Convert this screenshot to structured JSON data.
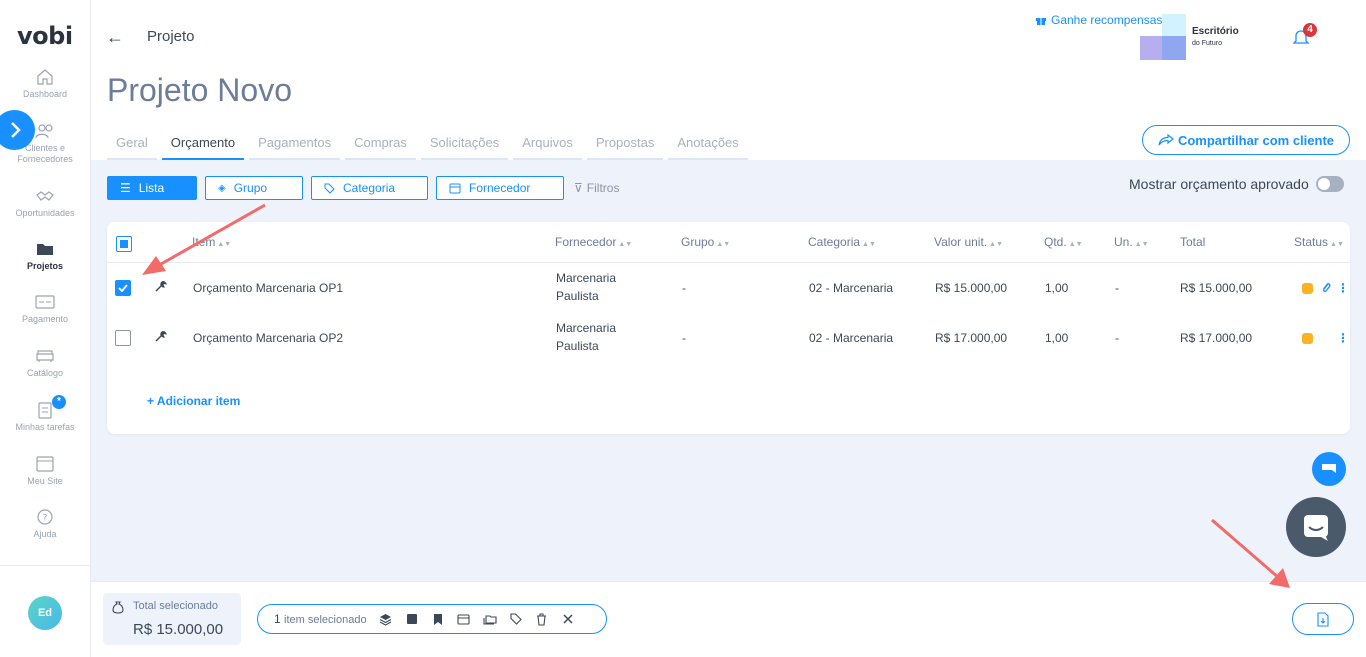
{
  "app": {
    "logo": "vobi"
  },
  "sidebar": {
    "items": [
      {
        "label": "Dashboard",
        "icon": "home-icon"
      },
      {
        "label": "Clientes e Fornecedores",
        "icon": "users-icon"
      },
      {
        "label": "Oportunidades",
        "icon": "handshake-icon"
      },
      {
        "label": "Projetos",
        "icon": "folder-icon",
        "active": true
      },
      {
        "label": "Pagamento",
        "icon": "payment-icon"
      },
      {
        "label": "Catálogo",
        "icon": "sofa-icon"
      },
      {
        "label": "Minhas tarefas",
        "icon": "clipboard-icon"
      },
      {
        "label": "Meu Site",
        "icon": "browser-icon"
      },
      {
        "label": "Ajuda",
        "icon": "help-icon"
      }
    ],
    "tasks_badge": "*",
    "avatar_initials": "Ed"
  },
  "header": {
    "breadcrumb": "Projeto",
    "title": "Projeto Novo",
    "rewards": "Ganhe recompensas!",
    "company_name": "Escritório",
    "company_sub": "do Futuro",
    "notifications_count": "4"
  },
  "tabs": [
    {
      "label": "Geral"
    },
    {
      "label": "Orçamento",
      "active": true
    },
    {
      "label": "Pagamentos"
    },
    {
      "label": "Compras"
    },
    {
      "label": "Solicitações"
    },
    {
      "label": "Arquivos"
    },
    {
      "label": "Propostas"
    },
    {
      "label": "Anotações"
    }
  ],
  "share_button": "Compartilhar com cliente",
  "filters": {
    "lista": "Lista",
    "grupo": "Grupo",
    "categoria": "Categoria",
    "fornecedor": "Fornecedor",
    "filtros": "Filtros",
    "approved_toggle": "Mostrar orçamento aprovado"
  },
  "table": {
    "columns": [
      "Item",
      "Fornecedor",
      "Grupo",
      "Categoria",
      "Valor unit.",
      "Qtd.",
      "Un.",
      "Total",
      "Status"
    ],
    "rows": [
      {
        "checked": true,
        "item": "Orçamento Marcenaria OP1",
        "fornecedor_1": "Marcenaria",
        "fornecedor_2": "Paulista",
        "grupo": "-",
        "categoria": "02 - Marcenaria",
        "valor": "R$ 15.000,00",
        "qtd": "1,00",
        "un": "-",
        "total": "R$ 15.000,00",
        "has_attachment": true
      },
      {
        "checked": false,
        "item": "Orçamento Marcenaria OP2",
        "fornecedor_1": "Marcenaria",
        "fornecedor_2": "Paulista",
        "grupo": "-",
        "categoria": "02 - Marcenaria",
        "valor": "R$ 17.000,00",
        "qtd": "1,00",
        "un": "-",
        "total": "R$ 17.000,00",
        "has_attachment": false
      }
    ],
    "add_item": "+ Adicionar item"
  },
  "footer": {
    "total_label": "Total selecionado",
    "total_value": "R$ 15.000,00",
    "selected_count": "1",
    "selected_label": "item selecionado"
  },
  "colors": {
    "accent": "#1890ff",
    "status": "#fbb321",
    "background": "#eef2fa"
  }
}
